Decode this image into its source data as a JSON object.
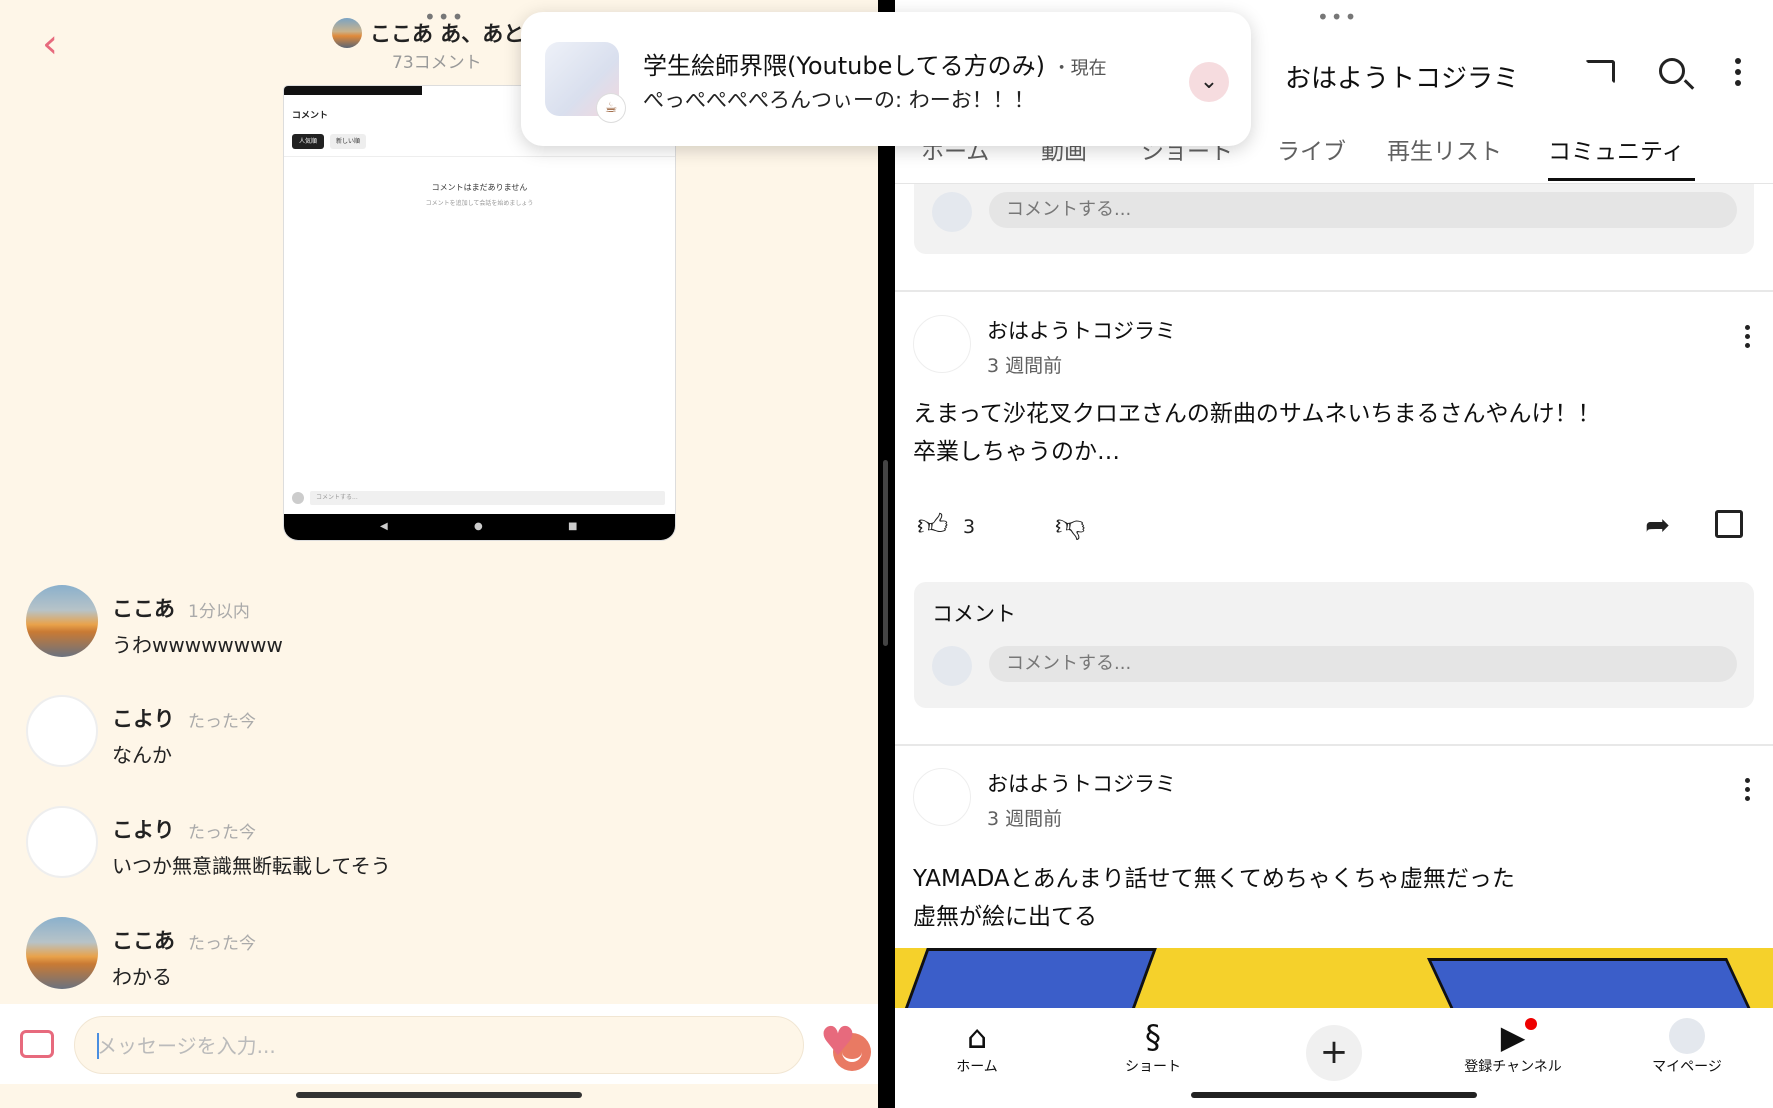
{
  "left": {
    "header": {
      "title": "ここあ あ、あと",
      "comment_count": "73コメント"
    },
    "embedded_screenshot": {
      "comment_title": "コメント",
      "tab_popular": "人気順",
      "tab_new": "新しい順",
      "empty_title": "コメントはまだありません",
      "empty_sub": "コメントを追加して会話を始めましょう",
      "input_placeholder": "コメントする..."
    },
    "messages": [
      {
        "name": "ここあ",
        "time": "1分以内",
        "text": "うわwwwwwwww",
        "avatar": "sunset"
      },
      {
        "name": "こより",
        "time": "たった今",
        "text": "なんか",
        "avatar": "sketch"
      },
      {
        "name": "こより",
        "time": "たった今",
        "text": "いつか無意識無断転載してそう",
        "avatar": "sketch"
      },
      {
        "name": "ここあ",
        "time": "たった今",
        "text": "わかる",
        "avatar": "sunset"
      }
    ],
    "composer": {
      "placeholder": "メッセージを入力..."
    }
  },
  "right": {
    "channel_name": "おはようトコジラミ",
    "tabs": [
      "ホーム",
      "動画",
      "ショート",
      "ライブ",
      "再生リスト",
      "コミュニティ"
    ],
    "active_tab": "コミュニティ",
    "comment_placeholder": "コメントする...",
    "posts": [
      {
        "author": "おはようトコジラミ",
        "date": "3 週間前",
        "lines": [
          "えまって沙花叉クロヱさんの新曲のサムネいちまるさんやんけ！！",
          "卒業しちゃうのか…"
        ],
        "likes": "3",
        "comment_label": "コメント"
      },
      {
        "author": "おはようトコジラミ",
        "date": "3 週間前",
        "lines": [
          "YAMADAとあんまり話せて無くてめちゃくちゃ虚無だった",
          "虚無が絵に出てる"
        ]
      }
    ],
    "bottom_nav": {
      "home": "ホーム",
      "shorts": "ショート",
      "subscriptions": "登録チャンネル",
      "mypage": "マイページ"
    }
  },
  "notification": {
    "title": "学生絵師界隈(Youtubeしてる方のみ)",
    "time": "・現在",
    "body": "ぺっぺぺぺぺろんつぃーの: わーお！！！"
  },
  "colors": {
    "accent_pink": "#e76a7d",
    "left_bg": "#fef6e8",
    "notification_dot": "#ee0000"
  }
}
